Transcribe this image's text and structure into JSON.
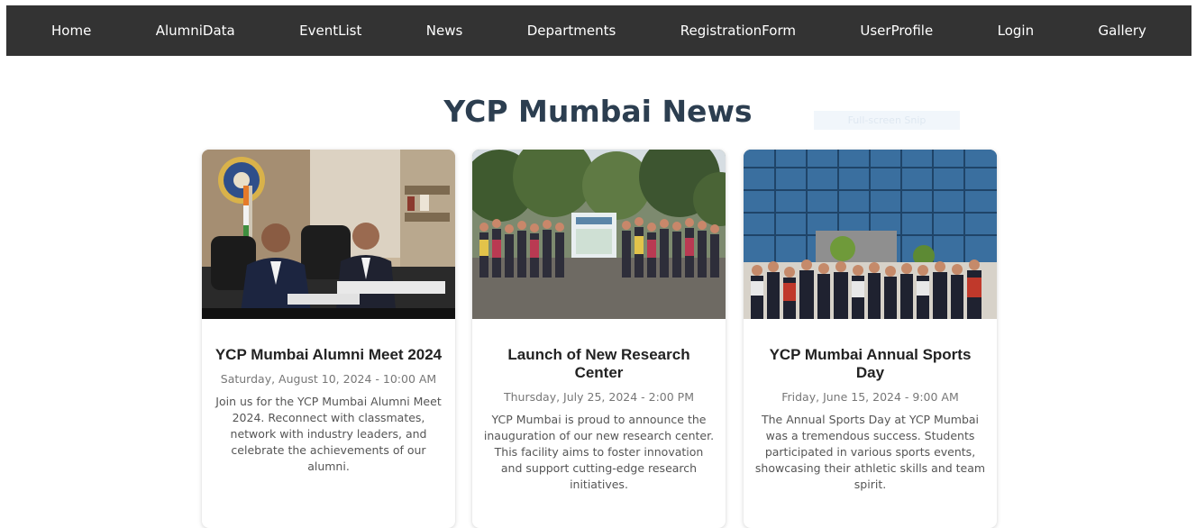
{
  "nav": {
    "items": [
      {
        "label": "Home"
      },
      {
        "label": "AlumniData"
      },
      {
        "label": "EventList"
      },
      {
        "label": "News"
      },
      {
        "label": "Departments"
      },
      {
        "label": "RegistrationForm"
      },
      {
        "label": "UserProfile"
      },
      {
        "label": "Login"
      },
      {
        "label": "Gallery"
      }
    ]
  },
  "page": {
    "title": "YCP Mumbai News",
    "overlay_text": "Full-screen Snip"
  },
  "news": [
    {
      "image": "officials-signing-photo",
      "title": "YCP Mumbai Alumni Meet 2024",
      "date": "Saturday, August 10, 2024 - 10:00 AM",
      "description": "Join us for the YCP Mumbai Alumni Meet 2024. Reconnect with classmates, network with industry leaders, and celebrate the achievements of our alumni."
    },
    {
      "image": "group-photo-outdoor",
      "title": "Launch of New Research Center",
      "date": "Thursday, July 25, 2024 - 2:00 PM",
      "description": "YCP Mumbai is proud to announce the inauguration of our new research center. This facility aims to foster innovation and support cutting-edge research initiatives."
    },
    {
      "image": "group-photo-building",
      "title": "YCP Mumbai Annual Sports Day",
      "date": "Friday, June 15, 2024 - 9:00 AM",
      "description": "The Annual Sports Day at YCP Mumbai was a tremendous success. Students participated in various sports events, showcasing their athletic skills and team spirit."
    }
  ]
}
